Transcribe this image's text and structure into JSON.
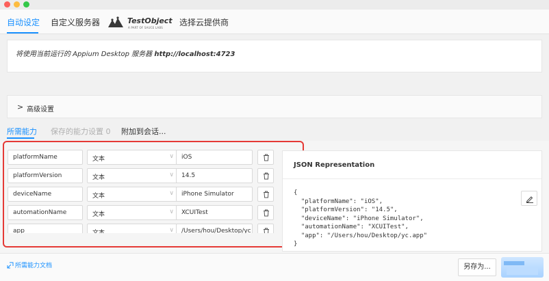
{
  "window": {
    "controls": [
      "close",
      "minimize",
      "zoom"
    ]
  },
  "top_tabs": {
    "auto": "自动设定",
    "custom": "自定义服务器",
    "testobject_name": "TestObject",
    "testobject_sub": "A PART OF SAUCE LABS",
    "cloud": "选择云提供商"
  },
  "server": {
    "prefix": "将使用当前运行的 Appium Desktop 服务器 ",
    "url": "http://localhost:4723"
  },
  "advanced": {
    "label": "高级设置"
  },
  "sub_tabs": {
    "required": "所需能力",
    "saved": "保存的能力设置 0",
    "attach": "附加到会话..."
  },
  "capabilities": [
    {
      "name": "platformName",
      "type": "文本",
      "value": "iOS"
    },
    {
      "name": "platformVersion",
      "type": "文本",
      "value": "14.5"
    },
    {
      "name": "deviceName",
      "type": "文本",
      "value": "iPhone Simulator"
    },
    {
      "name": "automationName",
      "type": "文本",
      "value": "XCUITest"
    },
    {
      "name": "app",
      "type": "文本",
      "value": "/Users/hou/Desktop/yc"
    }
  ],
  "json": {
    "title": "JSON Representation",
    "code": "{\n  \"platformName\": \"iOS\",\n  \"platformVersion\": \"14.5\",\n  \"deviceName\": \"iPhone Simulator\",\n  \"automationName\": \"XCUITest\",\n  \"app\": \"/Users/hou/Desktop/yc.app\"\n}"
  },
  "footer": {
    "doc_link": "所需能力文档",
    "save_as": "另存为..."
  },
  "colors": {
    "accent": "#1890ff",
    "highlight": "#e53935"
  }
}
